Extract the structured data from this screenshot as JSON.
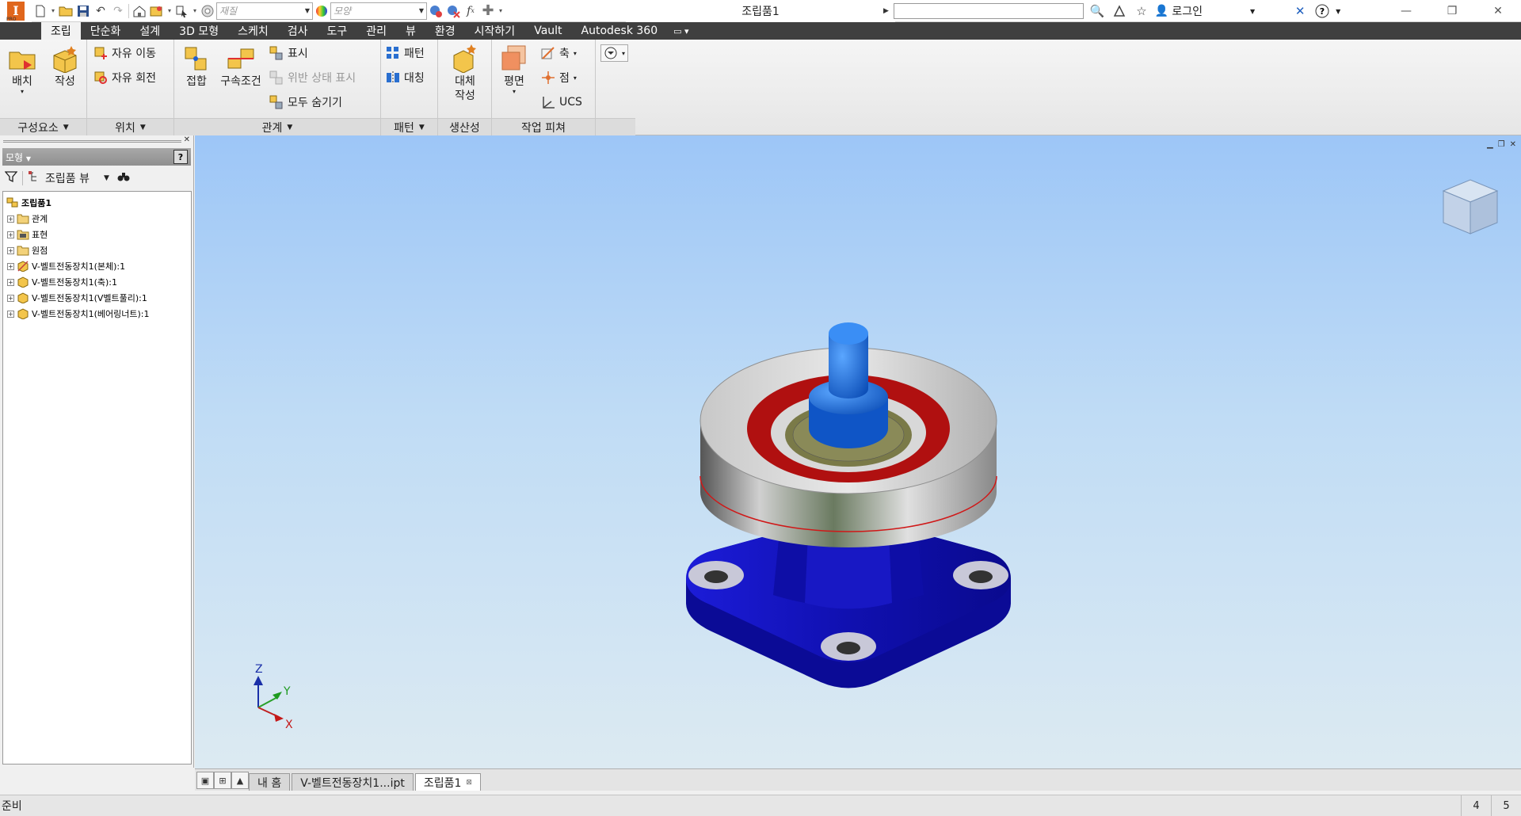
{
  "titlebar": {
    "material_placeholder": "재질",
    "appearance_placeholder": "모양",
    "document_title": "조립품1",
    "search_value": "",
    "login_label": "로그인"
  },
  "ribbon_tabs": [
    "조립",
    "단순화",
    "설계",
    "3D 모형",
    "스케치",
    "검사",
    "도구",
    "관리",
    "뷰",
    "환경",
    "시작하기",
    "Vault",
    "Autodesk 360"
  ],
  "ribbon": {
    "component": {
      "title": "구성요소",
      "place": "배치",
      "create": "작성"
    },
    "position": {
      "title": "위치",
      "free_move": "자유 이동",
      "free_rotate": "자유 회전"
    },
    "relationships": {
      "title": "관계",
      "joint": "접합",
      "constrain": "구속조건",
      "show": "표시",
      "show_sick": "위반 상태 표시",
      "hide_all": "모두 숨기기"
    },
    "pattern": {
      "title": "패턴",
      "pattern": "패턴",
      "mirror": "대칭"
    },
    "productivity": {
      "title": "생산성",
      "substitute_line1": "대체",
      "substitute_line2": "작성"
    },
    "work_features": {
      "title": "작업 피쳐",
      "plane": "평면",
      "axis": "축",
      "point": "점",
      "ucs": "UCS"
    }
  },
  "browser": {
    "header": "모형",
    "view_label": "조립품 뷰",
    "tree": {
      "root": "조립품1",
      "items": [
        "관계",
        "표현",
        "원점",
        "V-벨트전동장치1(본체):1",
        "V-벨트전동장치1(축):1",
        "V-벨트전동장치1(V벨트풀리):1",
        "V-벨트전동장치1(베어링너트):1"
      ]
    }
  },
  "viewport": {
    "triad": {
      "z": "Z",
      "y": "Y",
      "x": "X"
    },
    "colors": {
      "base": "#1515c8",
      "shaft": "#1a6fe0",
      "pulley_rim": "#c8c8c8",
      "groove": "#c01818",
      "washer": "#7a7a48"
    }
  },
  "doc_tabs": [
    "내 홈",
    "V-벨트전동장치1...ipt",
    "조립품1"
  ],
  "status": {
    "text": "준비",
    "num1": "4",
    "num2": "5"
  }
}
